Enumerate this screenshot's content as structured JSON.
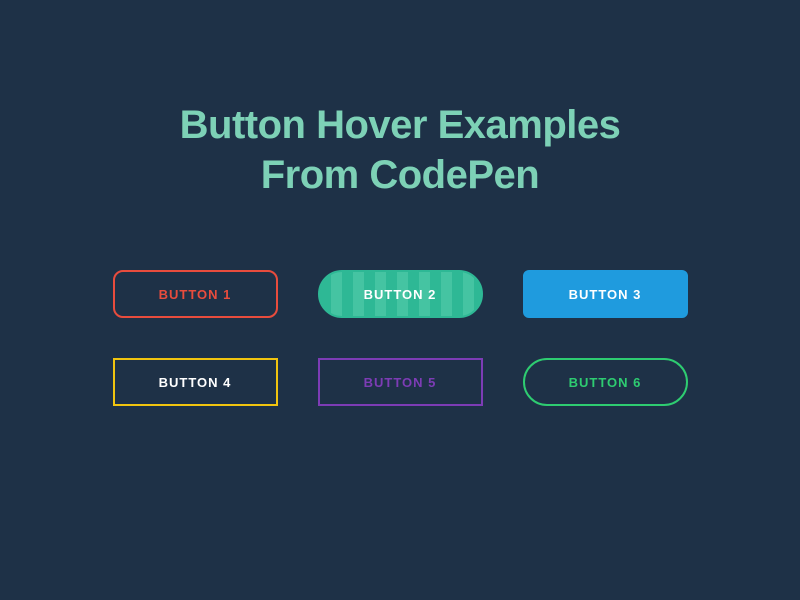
{
  "title": {
    "line1": "Button Hover Examples",
    "line2": "From CodePen"
  },
  "buttons": {
    "b1": "BUTTON 1",
    "b2": "BUTTON 2",
    "b3": "BUTTON 3",
    "b4": "BUTTON 4",
    "b5": "BUTTON 5",
    "b6": "BUTTON 6"
  },
  "colors": {
    "background": "#1e3147",
    "title": "#7dd1b6",
    "red": "#e84c3d",
    "teal": "#2eb895",
    "tealLight": "#45c4a2",
    "blue": "#1f9bde",
    "yellow": "#f1c40f",
    "purple": "#7d3cb5",
    "green": "#2ecc71",
    "white": "#ffffff"
  }
}
